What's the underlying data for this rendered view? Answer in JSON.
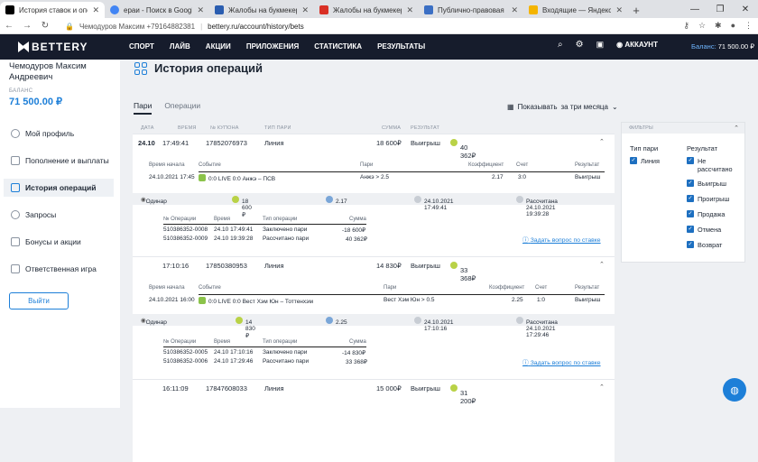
{
  "browser": {
    "tabs": [
      {
        "title": "История ставок и операци",
        "color": "#000000",
        "active": true
      },
      {
        "title": "ераи - Поиск в Google",
        "color": "#4285f4"
      },
      {
        "title": "Жалобы на букмекерски",
        "color": "#2a5db0"
      },
      {
        "title": "Жалобы на букмекерски",
        "color": "#d93025"
      },
      {
        "title": "Публично-правовая комп",
        "color": "#3b6fc4"
      },
      {
        "title": "Входящие — Яндекс.Почт",
        "color": "#f4b400"
      }
    ],
    "new_tab": "+",
    "url_user": "Чемодуров Максим +79164882381",
    "url": "bettery.ru/account/history/bets"
  },
  "nav": {
    "logo": "BETTERY",
    "items": [
      "СПОРТ",
      "ЛАЙВ",
      "АКЦИИ",
      "ПРИЛОЖЕНИЯ",
      "СТАТИСТИКА",
      "РЕЗУЛЬТАТЫ"
    ],
    "account": "АККАУНТ",
    "balance_label": "Баланс:",
    "balance_value": "71 500.00 ₽"
  },
  "sidebar": {
    "user_name": "Чемодуров Максим Андреевич",
    "balance_label": "БАЛАНС",
    "balance_value": "71 500.00 ₽",
    "items": [
      "Мой профиль",
      "Пополнение и выплаты",
      "История операций",
      "Запросы",
      "Бонусы и акции",
      "Ответственная игра"
    ],
    "logout": "Выйти"
  },
  "page": {
    "title": "История операций",
    "tabs": [
      "Пари",
      "Операции"
    ],
    "period_label": "Показывать",
    "period_value": "за три месяца"
  },
  "table": {
    "headers": [
      "ДАТА",
      "ВРЕМЯ",
      "№ КУПОНА",
      "ТИП ПАРИ",
      "СУММА",
      "РЕЗУЛЬТАТ"
    ],
    "bets": [
      {
        "date": "24.10",
        "time": "17:49:41",
        "coupon": "17852076973",
        "type": "Линия",
        "sum": "18 600₽",
        "result": "Выигрыш",
        "win": "40 362₽",
        "detail_headers": [
          "Время начала",
          "Событие",
          "Пари",
          "Коэффициент",
          "Счет",
          "Результат"
        ],
        "event": {
          "start": "24.10.2021 17:45",
          "name": "0:0 LIVE 0:0 Анжэ – ПСВ",
          "pari": "Анжэ > 2.5",
          "coef": "2.17",
          "score": "3:0",
          "result": "Выигрыш"
        },
        "ordinar": {
          "label": "Одинар",
          "sum": "18 600 ₽",
          "coef": "2.17",
          "placed": "24.10.2021 17:49:41",
          "settled": "Рассчитана 24.10.2021 19:39:28"
        },
        "ops_headers": [
          "№ Операции",
          "Время",
          "Тип операции",
          "Сумма"
        ],
        "ops": [
          {
            "id": "510386352-0008",
            "time": "24.10 17:49:41",
            "type": "Заключено пари",
            "sum": "-18 600₽"
          },
          {
            "id": "510386352-0009",
            "time": "24.10 19:39:28",
            "type": "Рассчитано пари",
            "sum": "40 362₽"
          }
        ],
        "ask": "Задать вопрос по ставке"
      },
      {
        "date": "",
        "time": "17:10:16",
        "coupon": "17850380953",
        "type": "Линия",
        "sum": "14 830₽",
        "result": "Выигрыш",
        "win": "33 368₽",
        "detail_headers": [
          "Время начала",
          "Событие",
          "Пари",
          "Коэффициент",
          "Счет",
          "Результат"
        ],
        "event": {
          "start": "24.10.2021 16:00",
          "name": "0:0 LIVE 0:0 Вест Хэм Юн – Тоттенхэм",
          "pari": "Вест Хэм Юн > 0.5",
          "coef": "2.25",
          "score": "1:0",
          "result": "Выигрыш"
        },
        "ordinar": {
          "label": "Одинар",
          "sum": "14 830 ₽",
          "coef": "2.25",
          "placed": "24.10.2021 17:10:16",
          "settled": "Рассчитана 24.10.2021 17:29:46"
        },
        "ops_headers": [
          "№ Операции",
          "Время",
          "Тип операции",
          "Сумма"
        ],
        "ops": [
          {
            "id": "510386352-0005",
            "time": "24.10 17:10:16",
            "type": "Заключено пари",
            "sum": "-14 830₽"
          },
          {
            "id": "510386352-0006",
            "time": "24.10 17:29:46",
            "type": "Рассчитано пари",
            "sum": "33 368₽"
          }
        ],
        "ask": "Задать вопрос по ставке"
      },
      {
        "date": "",
        "time": "16:11:09",
        "coupon": "17847608033",
        "type": "Линия",
        "sum": "15 000₽",
        "result": "Выигрыш",
        "win": "31 200₽"
      }
    ]
  },
  "filters": {
    "title": "ФИЛЬТРЫ",
    "type_title": "Тип пари",
    "types": [
      "Линия"
    ],
    "result_title": "Результат",
    "results": [
      "Не рассчитано",
      "Выигрыш",
      "Проигрыш",
      "Продажа",
      "Отмена",
      "Возврат"
    ]
  },
  "colors": {
    "accent": "#1d7fd8",
    "nav_bg": "#161c2c",
    "win_coin": "#b9d247"
  }
}
